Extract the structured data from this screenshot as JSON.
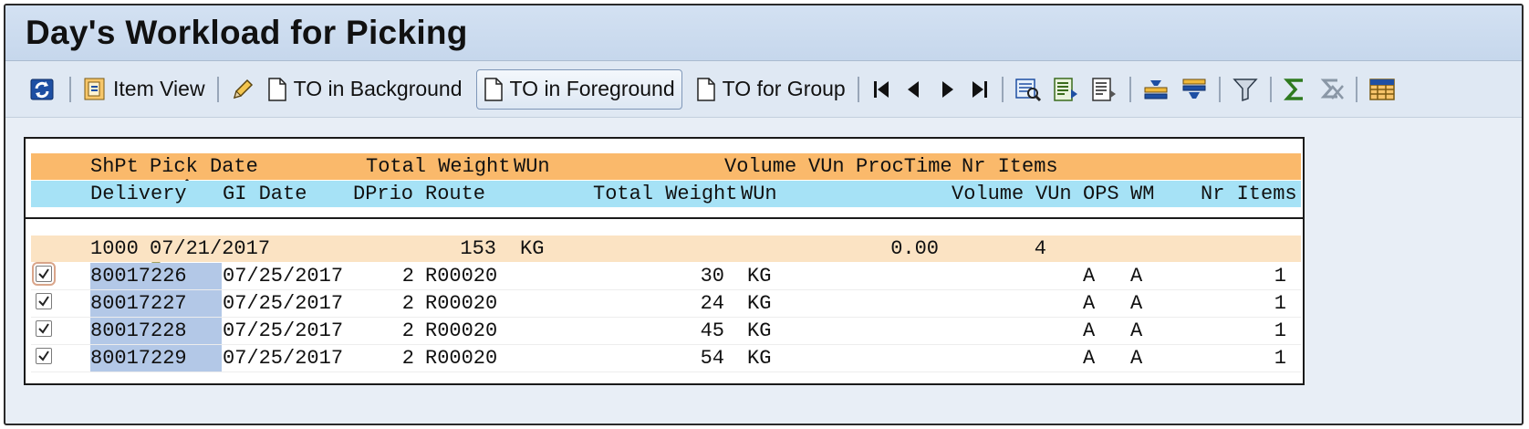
{
  "window": {
    "title": "Day's Workload for Picking"
  },
  "toolbar": {
    "item_view": "Item View",
    "to_background": "TO in Background",
    "to_foreground": "TO in Foreground",
    "to_group": "TO for Group",
    "icons": [
      "refresh-icon",
      "item-view-icon",
      "pencil-icon",
      "document-icon",
      "first-page-icon",
      "previous-page-icon",
      "next-page-icon",
      "last-page-icon",
      "details-icon",
      "export-icon",
      "layout-icon",
      "sort-ascending-icon",
      "sort-descending-icon",
      "filter-icon",
      "sum-icon",
      "subtotal-icon",
      "grid-icon"
    ]
  },
  "list": {
    "header1": {
      "shpt": "ShPt",
      "pick_date": "Pick Date",
      "total_weight": "Total Weight",
      "wun": "WUn",
      "volume": "Volume",
      "vun": "VUn",
      "proctime": "ProcTime",
      "nr_items": "Nr Items"
    },
    "header2": {
      "delivery": "Delivery",
      "gi_date": "GI Date",
      "dprio": "DPrio",
      "route": "Route",
      "total_weight": "Total Weight",
      "wun": "WUn",
      "volume": "Volume",
      "vun": "VUn",
      "ops": "OPS",
      "wm": "WM",
      "nr_items": "Nr Items"
    },
    "group": {
      "shpt": "1000",
      "pick_date": "07/21/2017",
      "total_weight": "153",
      "wun": "KG",
      "volume": "0.00",
      "nr_items": "4"
    },
    "items": [
      {
        "delivery": "80017226",
        "gi_date": "07/25/2017",
        "dprio": "2",
        "route": "R00020",
        "total_weight": "30",
        "wun": "KG",
        "ops": "A",
        "wm": "A",
        "nr_items": "1",
        "checked": true
      },
      {
        "delivery": "80017227",
        "gi_date": "07/25/2017",
        "dprio": "2",
        "route": "R00020",
        "total_weight": "24",
        "wun": "KG",
        "ops": "A",
        "wm": "A",
        "nr_items": "1",
        "checked": true
      },
      {
        "delivery": "80017228",
        "gi_date": "07/25/2017",
        "dprio": "2",
        "route": "R00020",
        "total_weight": "45",
        "wun": "KG",
        "ops": "A",
        "wm": "A",
        "nr_items": "1",
        "checked": true
      },
      {
        "delivery": "80017229",
        "gi_date": "07/25/2017",
        "dprio": "2",
        "route": "R00020",
        "total_weight": "54",
        "wun": "KG",
        "ops": "A",
        "wm": "A",
        "nr_items": "1",
        "checked": true
      }
    ]
  },
  "colors": {
    "header1_bg": "#fab96b",
    "header2_bg": "#a6e2f6",
    "group_bg": "#fbe3c3",
    "key_bg": "#b3c8e7"
  }
}
